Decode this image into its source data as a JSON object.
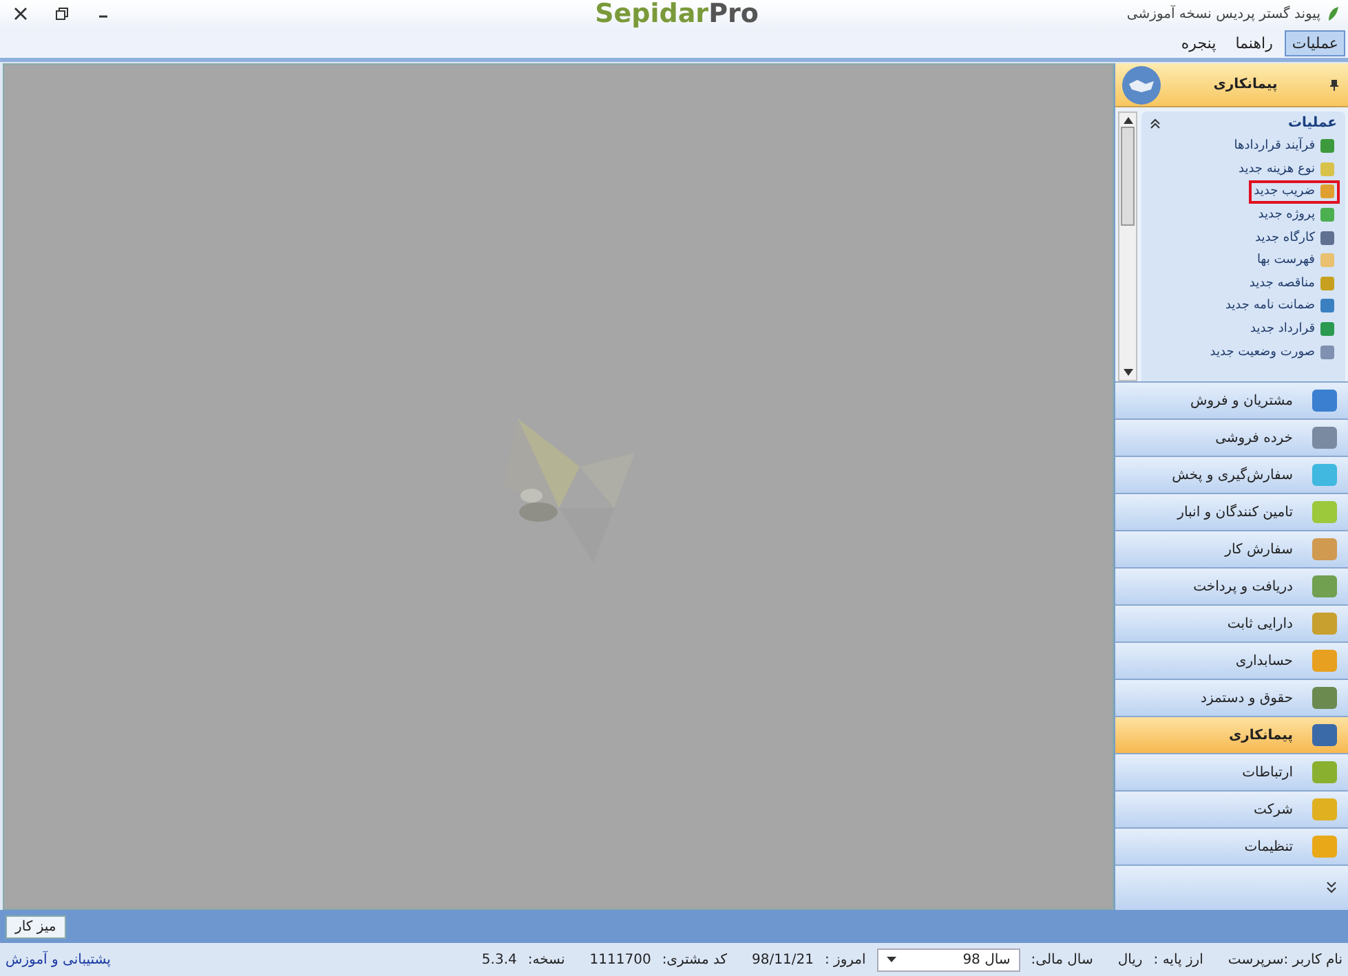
{
  "window": {
    "title": "پیوند گستر پردیس نسخه آموزشی",
    "logo": {
      "part_1": "Sepidar",
      "part_2": "Pro"
    }
  },
  "menu": [
    {
      "label": "عملیات",
      "selected": true
    },
    {
      "label": "راهنما",
      "selected": false
    },
    {
      "label": "پنجره",
      "selected": false
    }
  ],
  "task_panel": {
    "title": "پیمانکاری",
    "group": {
      "title": "عملیات",
      "expanded": true,
      "items": [
        {
          "label": "فرآیند قراردادها",
          "highlighted": false,
          "color": "#3c9a3c"
        },
        {
          "label": "نوع هزینه جدید",
          "highlighted": false,
          "color": "#d8c24a"
        },
        {
          "label": "ضریب جدید",
          "highlighted": true,
          "color": "#e0a030"
        },
        {
          "label": "پروژه جدید",
          "highlighted": false,
          "color": "#4caf50"
        },
        {
          "label": "کارگاه جدید",
          "highlighted": false,
          "color": "#607090"
        },
        {
          "label": "فهرست بها",
          "highlighted": false,
          "color": "#e8c070"
        },
        {
          "label": "مناقصه جدید",
          "highlighted": false,
          "color": "#c8a020"
        },
        {
          "label": "ضمانت نامه جدید",
          "highlighted": false,
          "color": "#3a80c0"
        },
        {
          "label": "قرارداد جدید",
          "highlighted": false,
          "color": "#2a9a50"
        },
        {
          "label": "صورت وضعیت جدید",
          "highlighted": false,
          "color": "#8090b0"
        }
      ]
    }
  },
  "modules": [
    {
      "label": "مشتریان و فروش",
      "selected": false,
      "color": "#3a7fd0"
    },
    {
      "label": "خرده فروشی",
      "selected": false,
      "color": "#7a8aa0"
    },
    {
      "label": "سفارش‌گیری و پخش",
      "selected": false,
      "color": "#40b8e0"
    },
    {
      "label": "تامین کنندگان و انبار",
      "selected": false,
      "color": "#9cc83c"
    },
    {
      "label": "سفارش کار",
      "selected": false,
      "color": "#d09a50"
    },
    {
      "label": "دریافت و پرداخت",
      "selected": false,
      "color": "#70a050"
    },
    {
      "label": "دارایی ثابت",
      "selected": false,
      "color": "#c8a030"
    },
    {
      "label": "حسابداری",
      "selected": false,
      "color": "#e8a020"
    },
    {
      "label": "حقوق و دستمزد",
      "selected": false,
      "color": "#6a8a50"
    },
    {
      "label": "پیمانکاری",
      "selected": true,
      "color": "#3a6aa8"
    },
    {
      "label": "ارتباطات",
      "selected": false,
      "color": "#8ab030"
    },
    {
      "label": "شرکت",
      "selected": false,
      "color": "#e0b020"
    },
    {
      "label": "تنظیمات",
      "selected": false,
      "color": "#e8a818"
    }
  ],
  "taskbar": {
    "button": "میز کار"
  },
  "status_bar": {
    "user": "نام کاربر :سرپرست",
    "currency_label": "ارز پایه :",
    "currency": "ریال",
    "fiscal_year_label": "سال مالی:",
    "fiscal_year": "سال 98",
    "today_label": "امروز :",
    "today": "98/11/21",
    "customer_code_label": "کد مشتری:",
    "customer_code": "1111700",
    "version_label": "نسخه:",
    "version": "5.3.4",
    "support_link": "پشتیبانی و آموزش"
  }
}
